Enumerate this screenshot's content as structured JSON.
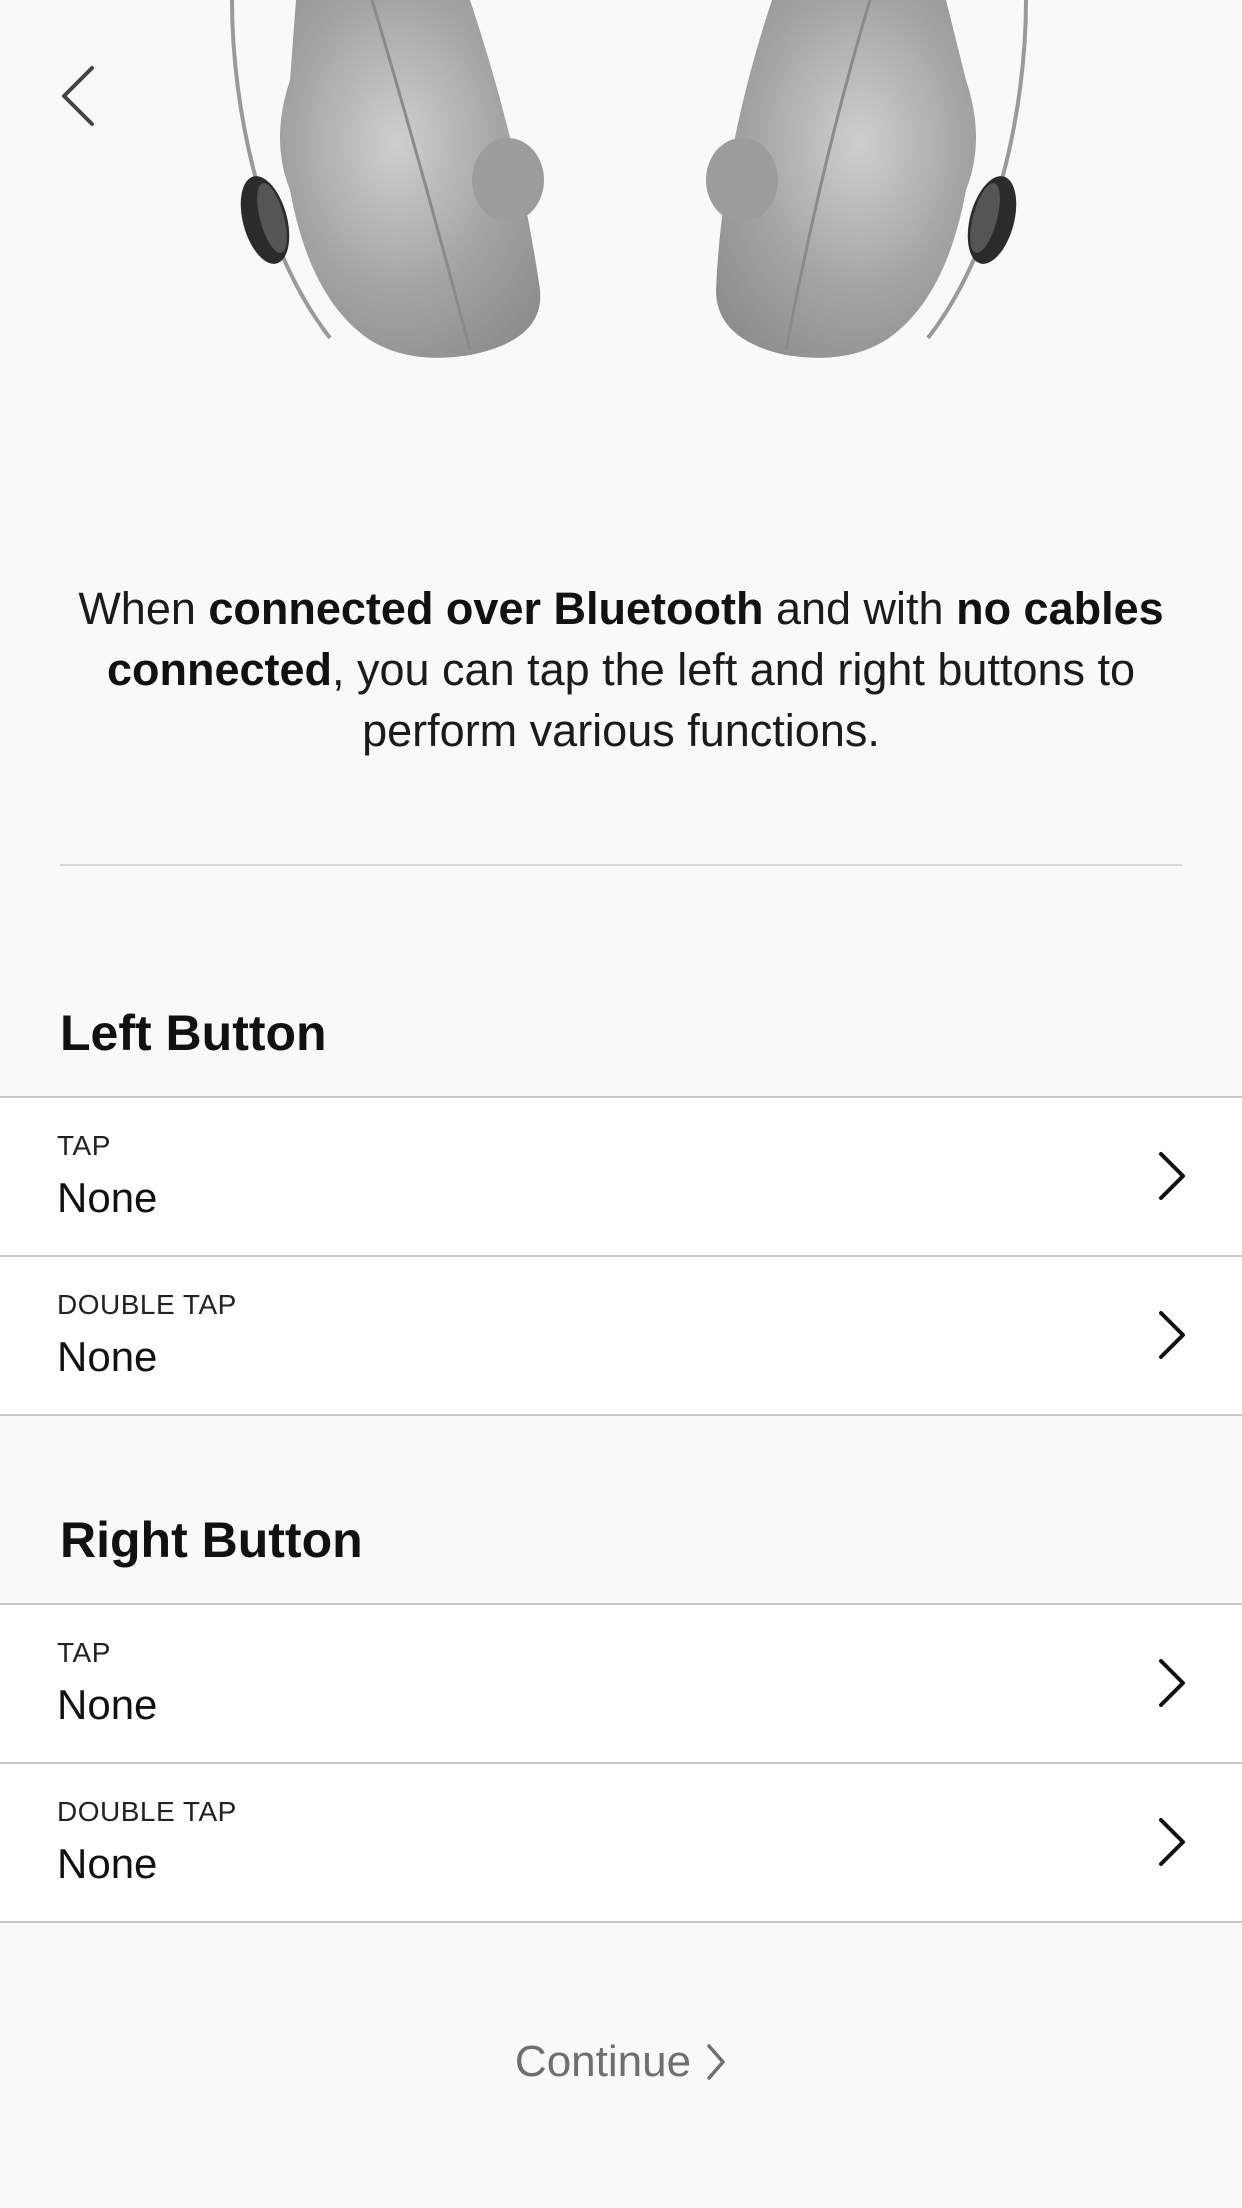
{
  "header": {
    "back_icon": "chevron-left-icon"
  },
  "hero": {
    "image": "headphones-earcups-illustration"
  },
  "intro": {
    "part1": "When ",
    "bold1": "connected over Bluetooth",
    "part2": " and with ",
    "bold2": "no cables connected",
    "part3": ", you can tap the left and right buttons to perform various functions."
  },
  "left_button": {
    "title": "Left Button",
    "rows": [
      {
        "label": "TAP",
        "value": "None",
        "icon": "chevron-right-icon"
      },
      {
        "label": "DOUBLE TAP",
        "value": "None",
        "icon": "chevron-right-icon"
      }
    ]
  },
  "right_button": {
    "title": "Right Button",
    "rows": [
      {
        "label": "TAP",
        "value": "None",
        "icon": "chevron-right-icon"
      },
      {
        "label": "DOUBLE TAP",
        "value": "None",
        "icon": "chevron-right-icon"
      }
    ]
  },
  "footer": {
    "continue_label": "Continue",
    "continue_icon": "chevron-right-icon"
  },
  "colors": {
    "background": "#f9f9f9",
    "list_background": "#ffffff",
    "divider": "#c9c9c9",
    "continue_text": "#6f6f6f"
  }
}
